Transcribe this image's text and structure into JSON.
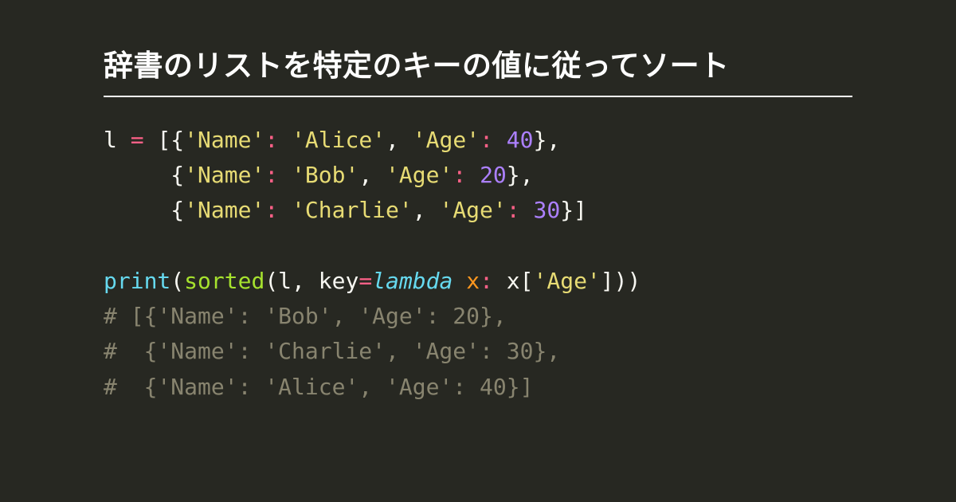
{
  "title": "辞書のリストを特定のキーの値に従ってソート",
  "code": {
    "l1": {
      "var": "l",
      "eq": " = ",
      "open": "[{",
      "k1": "'Name'",
      "c1": ": ",
      "v1": "'Alice'",
      "sep": ", ",
      "k2": "'Age'",
      "c2": ": ",
      "v2": "40",
      "close": "},"
    },
    "l2": {
      "pad": "     {",
      "k1": "'Name'",
      "c1": ": ",
      "v1": "'Bob'",
      "sep": ", ",
      "k2": "'Age'",
      "c2": ": ",
      "v2": "20",
      "close": "},"
    },
    "l3": {
      "pad": "     {",
      "k1": "'Name'",
      "c1": ": ",
      "v1": "'Charlie'",
      "sep": ", ",
      "k2": "'Age'",
      "c2": ": ",
      "v2": "30",
      "close": "}]"
    },
    "blank": "",
    "l5": {
      "print": "print",
      "op1": "(",
      "sorted": "sorted",
      "op2": "(l, key",
      "eq": "=",
      "lambda": "lambda",
      "sp": " ",
      "x": "x",
      "c": ": ",
      "xb": "x[",
      "age": "'Age'",
      "close": "]))"
    },
    "c1": "# [{'Name': 'Bob', 'Age': 20},",
    "c2": "#  {'Name': 'Charlie', 'Age': 30},",
    "c3": "#  {'Name': 'Alice', 'Age': 40}]"
  }
}
